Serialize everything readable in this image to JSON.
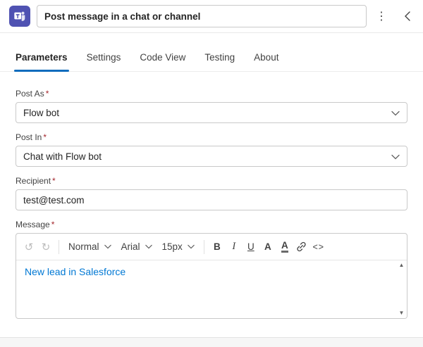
{
  "colors": {
    "accent": "#0f6cbd",
    "teams_brand": "#4f52b2",
    "link_text": "#0078d4",
    "required_asterisk": "#a4262c"
  },
  "header": {
    "title": "Post message in a chat or channel",
    "more_options_glyph": "⋮"
  },
  "tabs": [
    {
      "label": "Parameters",
      "active": true
    },
    {
      "label": "Settings",
      "active": false
    },
    {
      "label": "Code View",
      "active": false
    },
    {
      "label": "Testing",
      "active": false
    },
    {
      "label": "About",
      "active": false
    }
  ],
  "fields": {
    "post_as": {
      "label": "Post As",
      "required_mark": "*",
      "value": "Flow bot"
    },
    "post_in": {
      "label": "Post In",
      "required_mark": "*",
      "value": "Chat with Flow bot"
    },
    "recipient": {
      "label": "Recipient",
      "required_mark": "*",
      "value": "test@test.com"
    },
    "message": {
      "label": "Message",
      "required_mark": "*",
      "content": "New lead in Salesforce"
    }
  },
  "editor_toolbar": {
    "undo_glyph": "↺",
    "redo_glyph": "↻",
    "style_value": "Normal",
    "font_value": "Arial",
    "size_value": "15px",
    "bold": "B",
    "italic": "I",
    "underline": "U",
    "font_color": "A",
    "highlight": "A",
    "code": "<>",
    "scroll_up_glyph": "▲",
    "scroll_down_glyph": "▼"
  }
}
